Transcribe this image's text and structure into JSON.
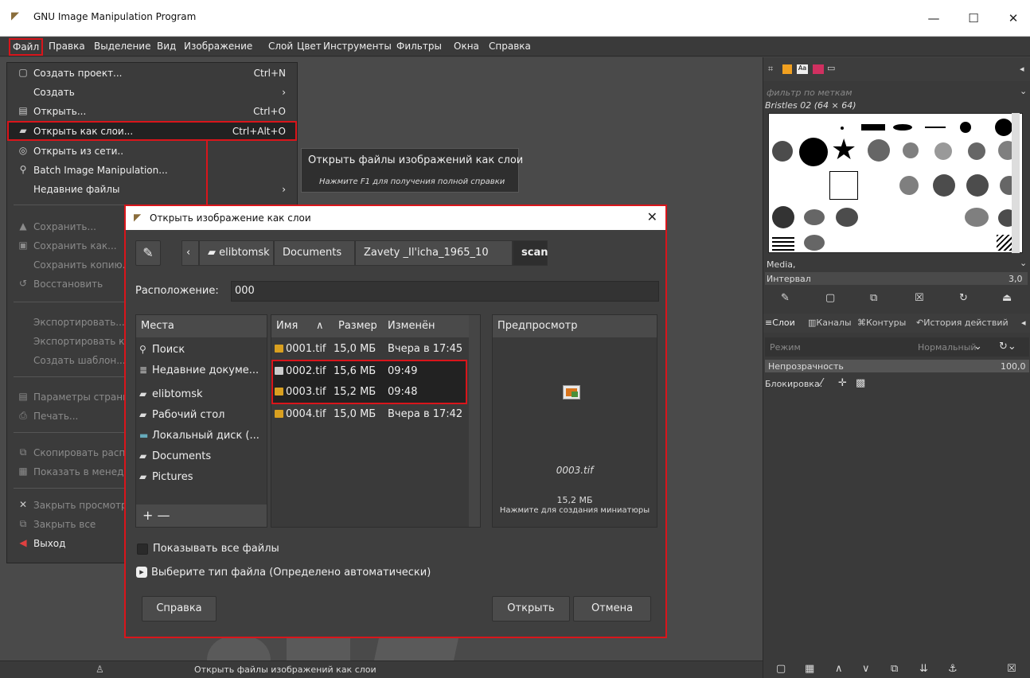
{
  "window": {
    "title": "GNU Image Manipulation Program",
    "minimize": "—",
    "maximize": "☐",
    "close": "✕"
  },
  "menubar": [
    "Файл",
    "Правка",
    "Выделение",
    "Вид",
    "Изображение",
    "Слой",
    "Цвет",
    "Инструменты",
    "Фильтры",
    "Окна",
    "Справка"
  ],
  "file_menu": {
    "create_project": {
      "label": "Создать проект...",
      "shortcut": "Ctrl+N"
    },
    "create": {
      "label": "Создать"
    },
    "open": {
      "label": "Открыть...",
      "shortcut": "Ctrl+O"
    },
    "open_as_layers": {
      "label": "Открыть как слои...",
      "shortcut": "Ctrl+Alt+O"
    },
    "open_location": {
      "label": "Открыть из сети.."
    },
    "batch": {
      "label": "Batch Image Manipulation..."
    },
    "recent": {
      "label": "Недавние файлы"
    },
    "save": {
      "label": "Сохранить..."
    },
    "save_as": {
      "label": "Сохранить как..."
    },
    "save_copy": {
      "label": "Сохранить копию..."
    },
    "revert": {
      "label": "Восстановить"
    },
    "export": {
      "label": "Экспортировать..."
    },
    "export_as": {
      "label": "Экспортировать ка"
    },
    "create_template": {
      "label": "Создать шаблон..."
    },
    "page_setup": {
      "label": "Параметры страни"
    },
    "print": {
      "label": "Печать..."
    },
    "copy_location": {
      "label": "Скопировать расп"
    },
    "show_in_manager": {
      "label": "Показать в менедж"
    },
    "close_view": {
      "label": "Закрыть просмотр"
    },
    "close_all": {
      "label": "Закрыть все"
    },
    "quit": {
      "label": "Выход"
    }
  },
  "tooltip": {
    "title": "Открыть файлы изображений как слои",
    "hint": "Нажмите F1 для получения полной справки"
  },
  "status": "Открыть файлы изображений как слои",
  "dialog": {
    "title": "Открыть изображение как слои",
    "breadcrumbs": [
      "elibtomsk",
      "Documents",
      "Zavety _Il'icha_1965_10",
      "scan"
    ],
    "location_label": "Расположение:",
    "location_value": "000",
    "places_header": "Места",
    "places": [
      "Поиск",
      "Недавние докуме...",
      "elibtomsk",
      "Рабочий стол",
      "Локальный диск (...",
      "Documents",
      "Pictures"
    ],
    "places_footer": "+  —",
    "columns": {
      "name": "Имя",
      "size": "Размер",
      "modified": "Изменён"
    },
    "files": [
      {
        "name": "0001.tif",
        "size": "15,0 МБ",
        "modified": "Вчера в 17:45"
      },
      {
        "name": "0002.tif",
        "size": "15,6 МБ",
        "modified": "09:49"
      },
      {
        "name": "0003.tif",
        "size": "15,2 МБ",
        "modified": "09:48"
      },
      {
        "name": "0004.tif",
        "size": "15,0 МБ",
        "modified": "Вчера в 17:42"
      }
    ],
    "preview_header": "Предпросмотр",
    "preview_filename": "0003.tif",
    "preview_size": "15,2 МБ",
    "preview_hint": "Нажмите для создания миниатюры",
    "show_all_files": "Показывать все файлы",
    "file_type": "Выберите тип файла (Определено автоматически)",
    "help_button": "Справка",
    "open_button": "Открыть",
    "cancel_button": "Отмена"
  },
  "right_panel": {
    "filter_placeholder": "фильтр по меткам",
    "brush_name": "Bristles 02 (64 × 64)",
    "media": "Media,",
    "spacing_label": "Интервал",
    "spacing_value": "3,0",
    "tabs": [
      "Слои",
      "Каналы",
      "Контуры",
      "История действий"
    ],
    "mode_label": "Режим",
    "mode_value": "Нормальный",
    "opacity_label": "Непрозрачность",
    "opacity_value": "100,0",
    "lock_label": "Блокировка:"
  }
}
